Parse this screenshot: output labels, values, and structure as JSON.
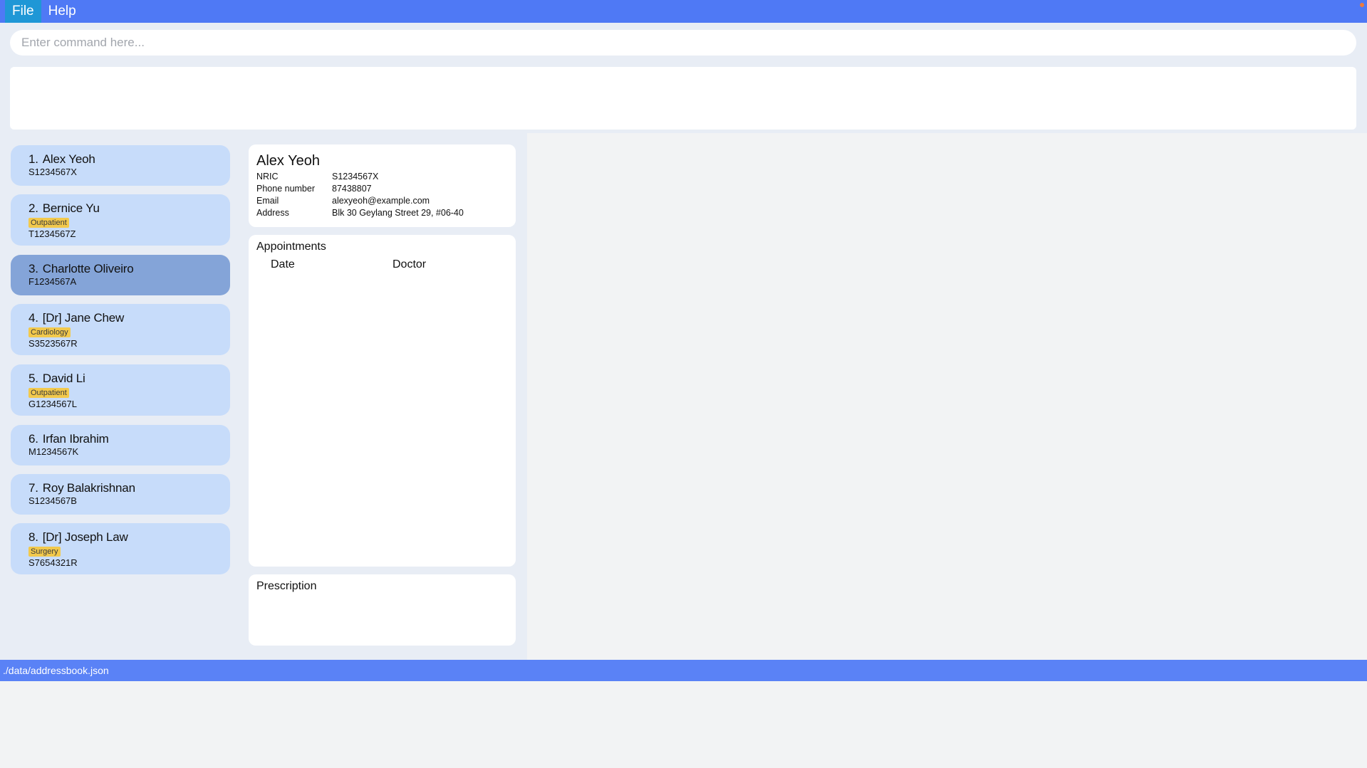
{
  "menu": {
    "file_label": "File",
    "help_label": "Help"
  },
  "command": {
    "placeholder": "Enter command here...",
    "value": ""
  },
  "result": {
    "text": ""
  },
  "persons": [
    {
      "index": "1.",
      "name": "Alex Yeoh",
      "tag": "",
      "nric": "S1234567X"
    },
    {
      "index": "2.",
      "name": "Bernice Yu",
      "tag": "Outpatient",
      "nric": "T1234567Z"
    },
    {
      "index": "3.",
      "name": "Charlotte Oliveiro",
      "tag": "",
      "nric": "F1234567A"
    },
    {
      "index": "4.",
      "name": "[Dr] Jane Chew",
      "tag": "Cardiology",
      "nric": "S3523567R"
    },
    {
      "index": "5.",
      "name": "David Li",
      "tag": "Outpatient",
      "nric": "G1234567L"
    },
    {
      "index": "6.",
      "name": "Irfan Ibrahim",
      "tag": "",
      "nric": "M1234567K"
    },
    {
      "index": "7.",
      "name": "Roy Balakrishnan",
      "tag": "",
      "nric": "S1234567B"
    },
    {
      "index": "8.",
      "name": "[Dr] Joseph Law",
      "tag": "Surgery",
      "nric": "S7654321R"
    }
  ],
  "colors": {
    "menubar": "#4f79f5",
    "card": "#c7dcfa",
    "card_selected": "#84a4d8",
    "tag": "#f2c94c",
    "statusbar": "#5a82f6"
  },
  "detail": {
    "name": "Alex Yeoh",
    "nric_label": "NRIC",
    "nric": "S1234567X",
    "phone_label": "Phone number",
    "phone": "87438807",
    "email_label": "Email",
    "email": "alexyeoh@example.com",
    "address_label": "Address",
    "address": "Blk 30 Geylang Street 29, #06-40"
  },
  "appointments": {
    "title": "Appointments",
    "col_date": "Date",
    "col_doctor": "Doctor"
  },
  "prescription": {
    "title": "Prescription"
  },
  "status": {
    "path": "./data/addressbook.json"
  }
}
